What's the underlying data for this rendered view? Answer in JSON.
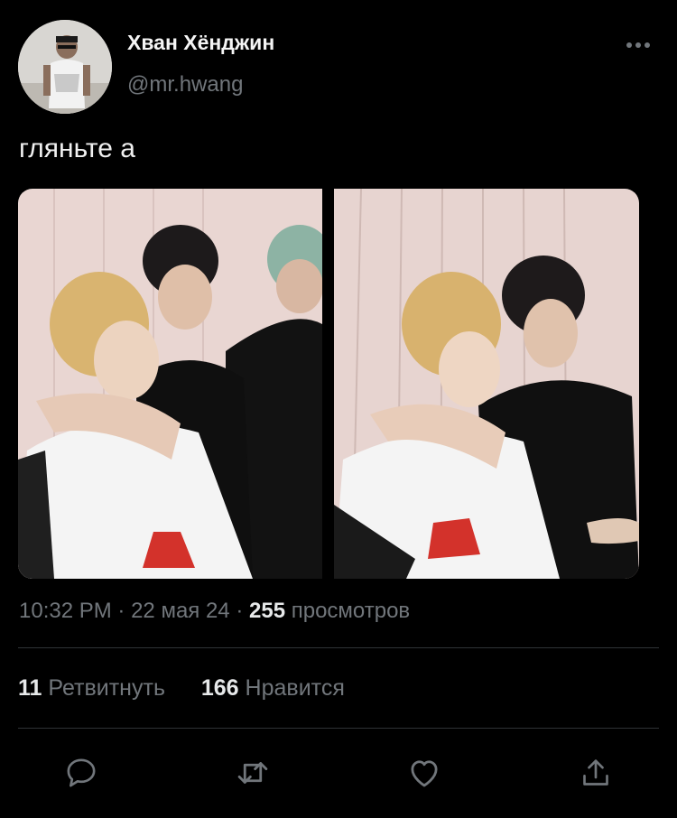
{
  "tweet": {
    "author_name": "Хван Хёнджин",
    "author_handle": "@mr.hwang",
    "text": "гляньте а"
  },
  "meta": {
    "time": "10:32 PM",
    "date": "22 мая 24",
    "separator": "·",
    "views_count": "255",
    "views_label": "просмотров"
  },
  "stats": {
    "retweets_count": "11",
    "retweets_label": "Ретвитнуть",
    "likes_count": "166",
    "likes_label": "Нравится"
  },
  "icons": {
    "more": "more-horizontal-icon",
    "reply": "reply-icon",
    "retweet": "retweet-icon",
    "like": "heart-icon",
    "share": "share-icon"
  },
  "colors": {
    "background": "#000000",
    "primary_text": "#e7e9ea",
    "secondary_text": "#71767b",
    "divider": "#2f3336"
  }
}
